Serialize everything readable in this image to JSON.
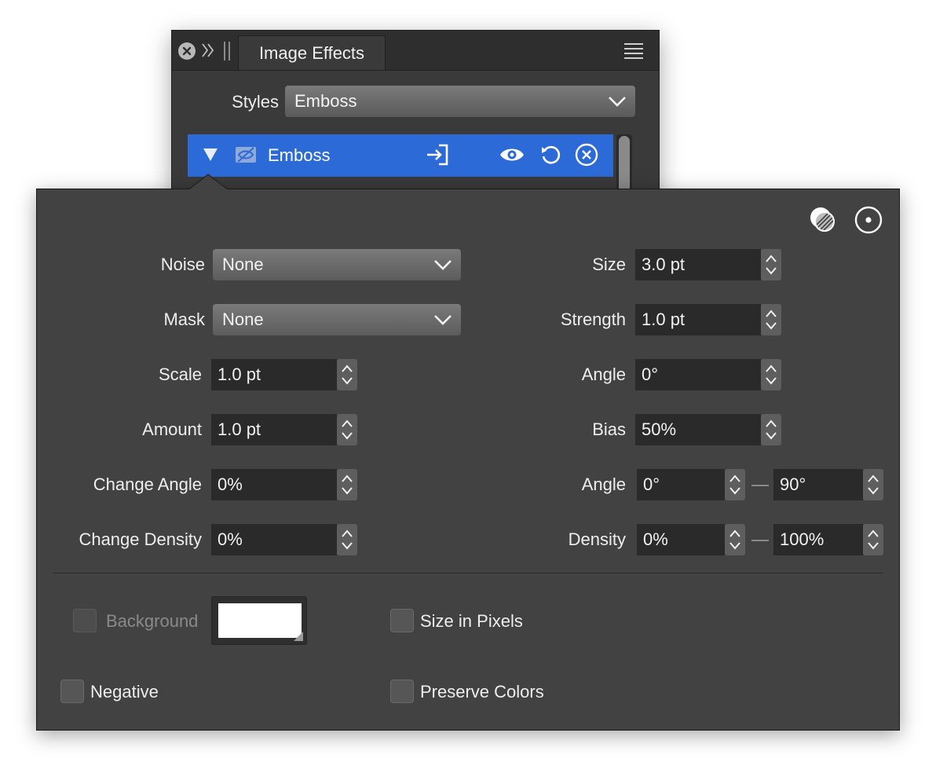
{
  "panel": {
    "tab_title": "Image Effects",
    "styles_label": "Styles",
    "styles_value": "Emboss",
    "effect_row": {
      "label": "Emboss"
    },
    "accent_color": "#2c6ad8"
  },
  "popover": {
    "left_fields": {
      "noise": {
        "label": "Noise",
        "value": "None"
      },
      "mask": {
        "label": "Mask",
        "value": "None"
      },
      "scale": {
        "label": "Scale",
        "value": "1.0 pt"
      },
      "amount": {
        "label": "Amount",
        "value": "1.0 pt"
      },
      "change_angle": {
        "label": "Change Angle",
        "value": "0%"
      },
      "change_density": {
        "label": "Change Density",
        "value": "0%"
      }
    },
    "right_fields": {
      "size": {
        "label": "Size",
        "value": "3.0 pt"
      },
      "strength": {
        "label": "Strength",
        "value": "1.0 pt"
      },
      "angle": {
        "label": "Angle",
        "value": "0°"
      },
      "bias": {
        "label": "Bias",
        "value": "50%"
      },
      "angle_range": {
        "label": "Angle",
        "from": "0°",
        "to": "90°"
      },
      "density_range": {
        "label": "Density",
        "from": "0%",
        "to": "100%"
      }
    },
    "options": {
      "background": {
        "label": "Background",
        "checked": false,
        "enabled": false,
        "color": "#ffffff"
      },
      "size_in_pixels": {
        "label": "Size in Pixels",
        "checked": false
      },
      "negative": {
        "label": "Negative",
        "checked": false
      },
      "preserve_colors": {
        "label": "Preserve Colors",
        "checked": false
      }
    }
  }
}
